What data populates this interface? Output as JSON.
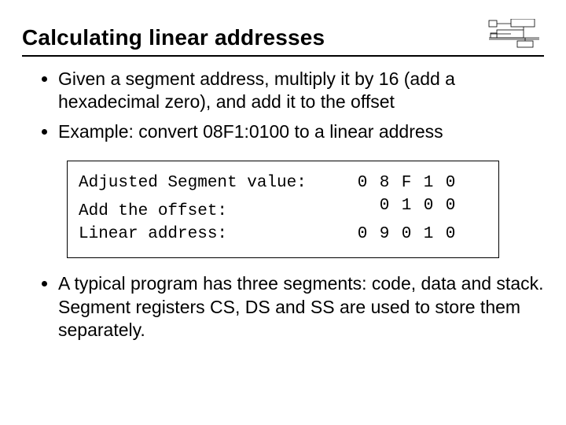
{
  "title": "Calculating linear addresses",
  "bullets": {
    "b0": "Given a segment address, multiply it by 16 (add a hexadecimal zero), and add it to the offset",
    "b1": "Example: convert 08F1:0100 to a linear address",
    "b2": "A typical program has three segments: code, data and stack. Segment registers CS, DS and SS are used to store them separately."
  },
  "calc": {
    "rows": [
      {
        "label": "Adjusted Segment value:",
        "d0": "0",
        "d1": "8",
        "d2": "F",
        "d3": "1",
        "d4": "0"
      },
      {
        "label": "Add the offset:",
        "d0": "",
        "d1": "0",
        "d2": "1",
        "d3": "0",
        "d4": "0"
      },
      {
        "label": "Linear address:",
        "d0": "0",
        "d1": "9",
        "d2": "0",
        "d3": "1",
        "d4": "0"
      }
    ]
  }
}
